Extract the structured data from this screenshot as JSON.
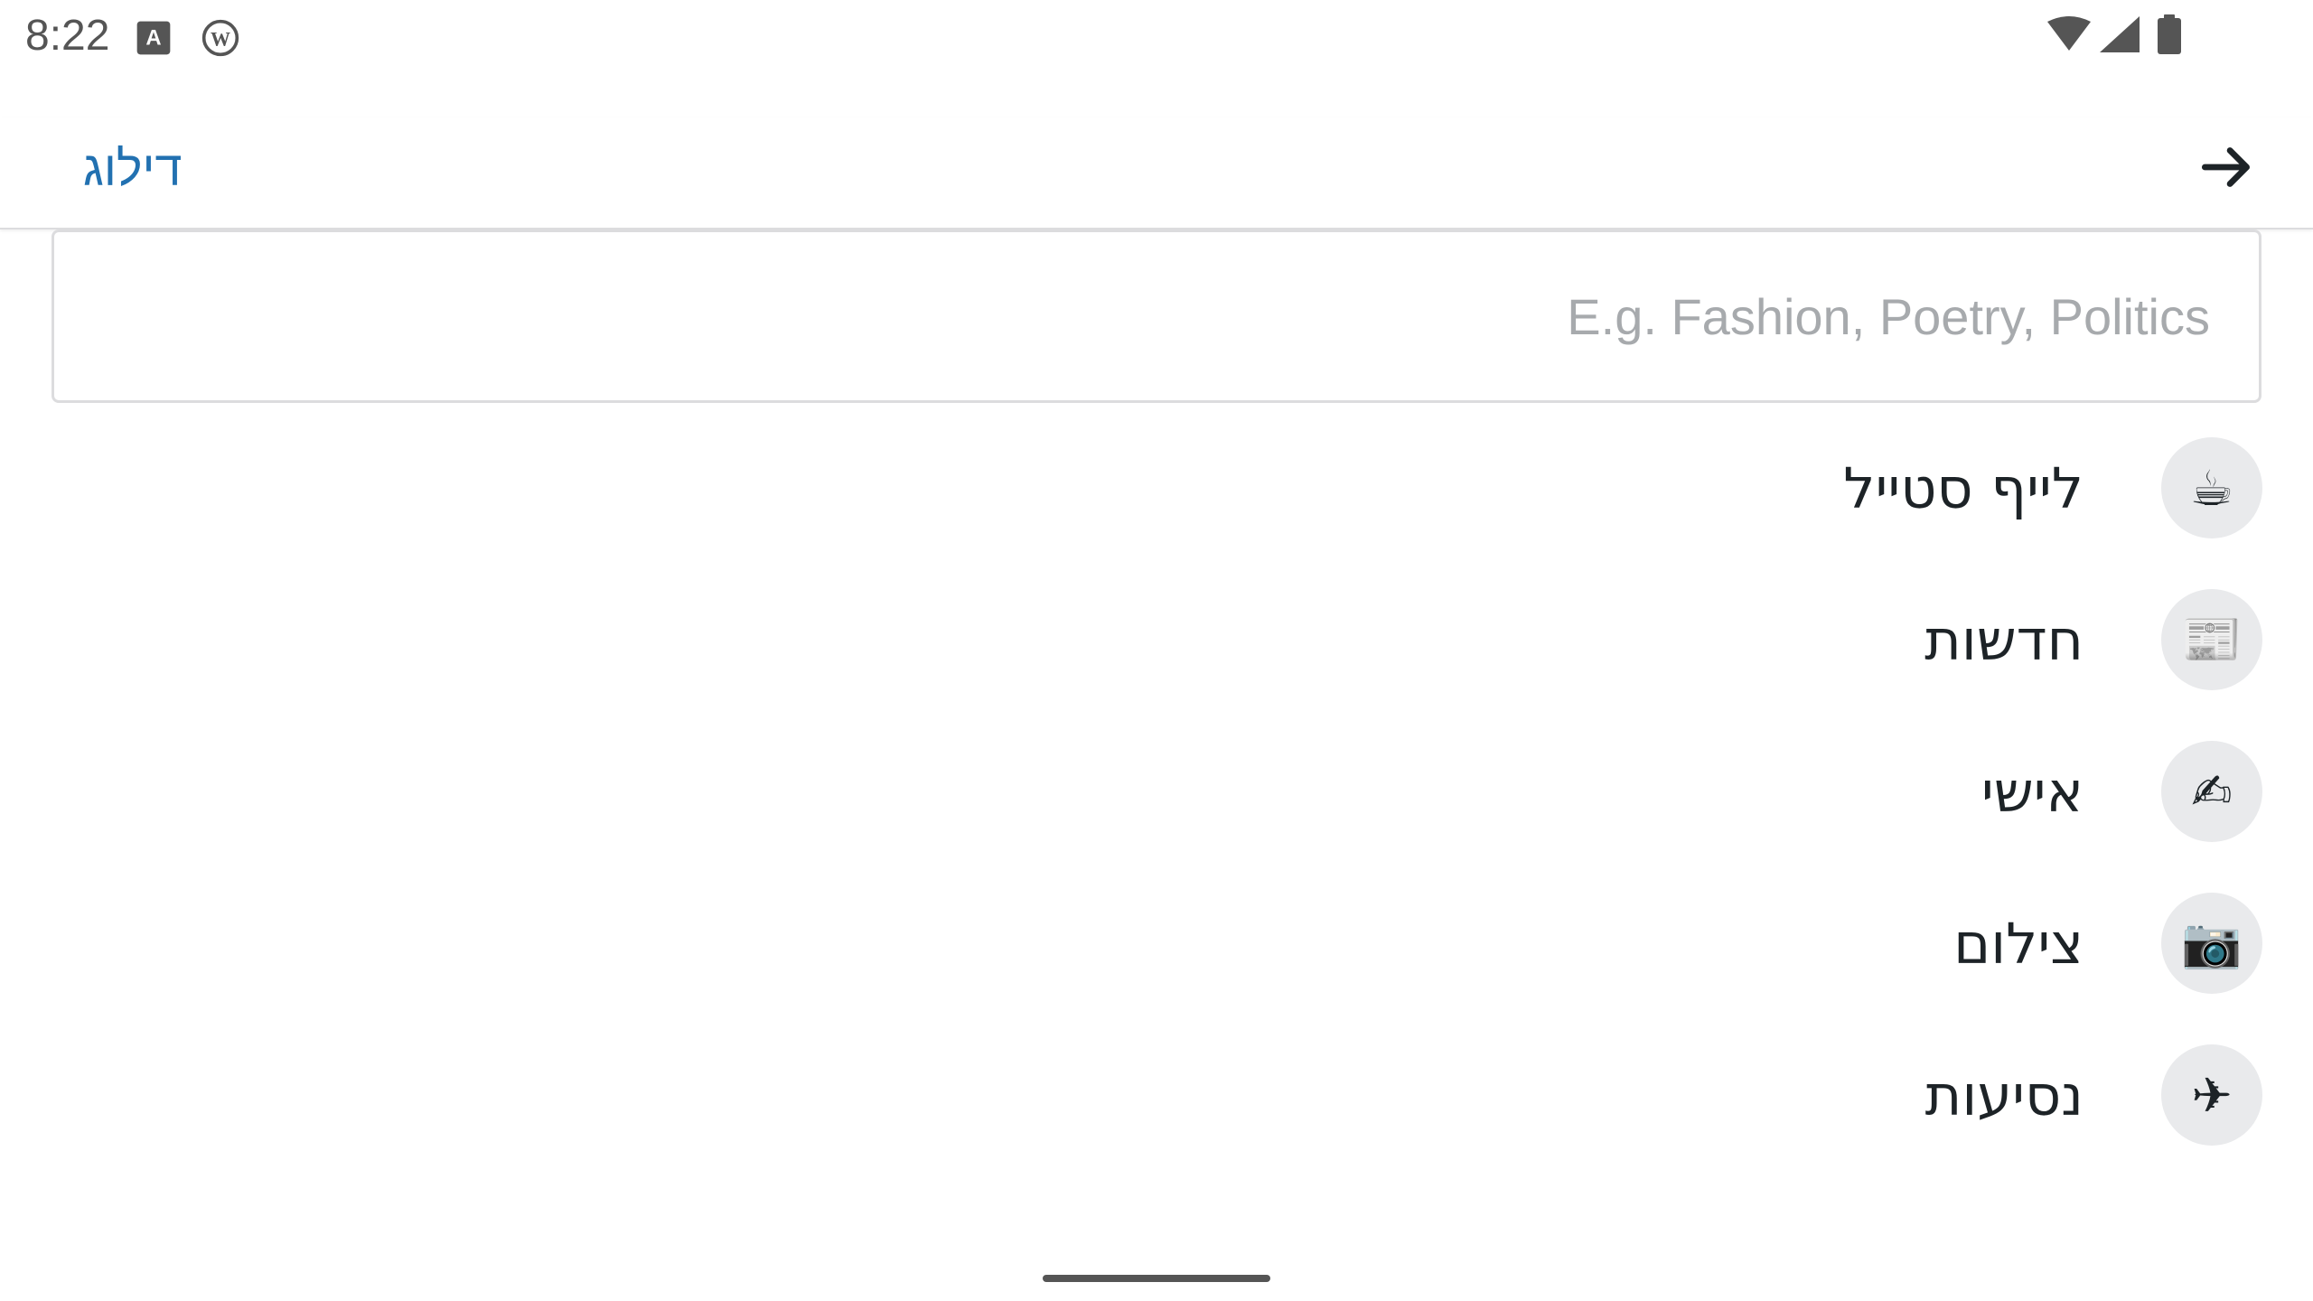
{
  "status_bar": {
    "time": "8:22",
    "left_icons": [
      "text-a-icon",
      "wordpress-icon"
    ],
    "right_icons": [
      "wifi-icon",
      "cellular-signal-icon",
      "battery-icon"
    ]
  },
  "app_bar": {
    "skip_label": "דילוג",
    "back_icon": "arrow-forward-icon",
    "accent_color": "#2271b1"
  },
  "search": {
    "placeholder": "E.g. Fashion, Poetry, Politics",
    "value": ""
  },
  "topics": [
    {
      "label": "לייף סטייל",
      "emoji": "☕",
      "icon": "coffee-icon"
    },
    {
      "label": "חדשות",
      "emoji": "📰",
      "icon": "newspaper-icon"
    },
    {
      "label": "אישי",
      "emoji": "✍",
      "icon": "writing-hand-icon"
    },
    {
      "label": "צילום",
      "emoji": "📷",
      "icon": "camera-icon"
    },
    {
      "label": "נסיעות",
      "emoji": "✈",
      "icon": "airplane-icon"
    }
  ]
}
